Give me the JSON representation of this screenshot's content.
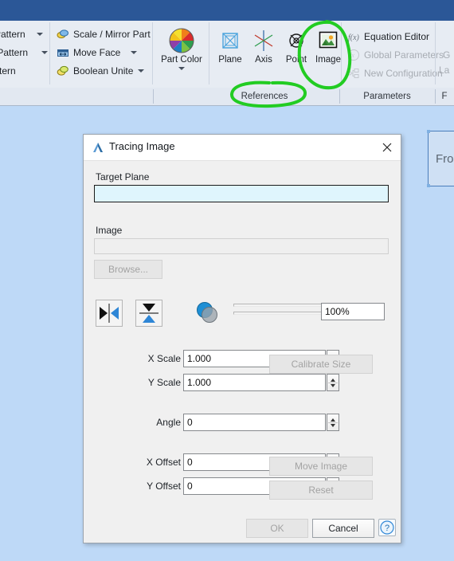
{
  "window": {
    "titlebar_color": "#2b5797",
    "viewport_bg": "#bed9f7"
  },
  "ribbon": {
    "groups": [
      {
        "caption": "References"
      },
      {
        "caption": "Parameters"
      },
      {
        "caption": "F"
      }
    ],
    "pattern_items": [
      {
        "label": "Pattern",
        "has_caret": true
      },
      {
        "label": "r Pattern",
        "has_caret": true
      },
      {
        "label": "attern",
        "has_caret": false
      }
    ],
    "modify_items": [
      {
        "label": "Scale / Mirror Part",
        "icon": "scale-mirror-icon",
        "has_caret": false
      },
      {
        "label": "Move Face",
        "icon": "move-face-icon",
        "has_caret": true
      },
      {
        "label": "Boolean Unite",
        "icon": "boolean-unite-icon",
        "has_caret": true
      }
    ],
    "part_color": {
      "label": "Part Color",
      "icon": "color-wheel-icon"
    },
    "reference_buttons": [
      {
        "label": "Plane",
        "icon": "plane-icon"
      },
      {
        "label": "Axis",
        "icon": "axis-icon"
      },
      {
        "label": "Point",
        "icon": "point-icon"
      },
      {
        "label": "Image",
        "icon": "image-icon"
      }
    ],
    "parameter_items": [
      {
        "label": "Equation Editor",
        "icon": "fx-icon",
        "disabled": false
      },
      {
        "label": "Global Parameters",
        "icon": "fx-icon",
        "disabled": true
      },
      {
        "label": "New Configuration",
        "icon": "configuration-icon",
        "disabled": true
      }
    ],
    "clipped_right": {
      "line1": "G",
      "line2": "La"
    }
  },
  "side_tile": {
    "label": "Fro"
  },
  "annotations": {
    "color": "#22cc22",
    "marks": [
      {
        "name": "circle-image-button"
      },
      {
        "name": "circle-references-caption"
      }
    ]
  },
  "dialog": {
    "title": "Tracing Image",
    "title_icon": "alibre-a-icon",
    "close_icon": "close-icon",
    "target_plane": {
      "label": "Target Plane",
      "value": "",
      "placeholder": ""
    },
    "image": {
      "label": "Image",
      "value": "",
      "placeholder": "",
      "browse_label": "Browse...",
      "browse_disabled": true
    },
    "flip_buttons": [
      {
        "name": "flip-horizontal-button",
        "icon": "flip-horizontal-icon"
      },
      {
        "name": "flip-vertical-button",
        "icon": "flip-vertical-icon"
      }
    ],
    "opacity": {
      "icon": "transparency-icon",
      "value": "100%",
      "slider_percent": 100
    },
    "fields": [
      {
        "name": "x-scale",
        "label": "X Scale",
        "value": "1.000"
      },
      {
        "name": "y-scale",
        "label": "Y Scale",
        "value": "1.000"
      },
      {
        "name": "angle",
        "label": "Angle",
        "value": "0"
      },
      {
        "name": "x-offset",
        "label": "X Offset",
        "value": "0"
      },
      {
        "name": "y-offset",
        "label": "Y Offset",
        "value": "0"
      }
    ],
    "side_buttons": [
      {
        "name": "calibrate-size-button",
        "label": "Calibrate Size",
        "disabled": true
      },
      {
        "name": "move-image-button",
        "label": "Move Image",
        "disabled": true
      },
      {
        "name": "reset-button",
        "label": "Reset",
        "disabled": true
      }
    ],
    "footer": {
      "ok_label": "OK",
      "ok_disabled": true,
      "cancel_label": "Cancel",
      "help_label": "?"
    }
  }
}
